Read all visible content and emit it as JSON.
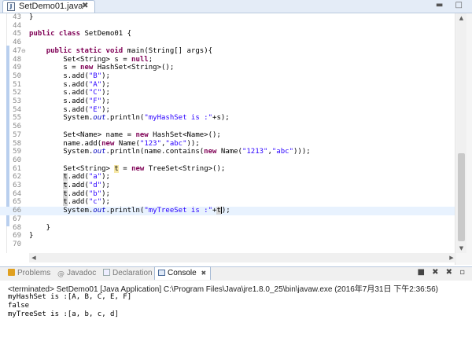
{
  "editor_tab": {
    "filename": "SetDemo01.java",
    "close": "✖"
  },
  "window_controls": "▬ □",
  "code_lines": [
    {
      "num": "43",
      "segments": [
        {
          "t": "}",
          "c": ""
        }
      ]
    },
    {
      "num": "44",
      "segments": []
    },
    {
      "num": "45",
      "segments": [
        {
          "t": "public class ",
          "c": "kw"
        },
        {
          "t": "SetDemo01 {",
          "c": ""
        }
      ]
    },
    {
      "num": "46",
      "segments": []
    },
    {
      "num": "47",
      "fold": "⊖",
      "segments": [
        {
          "t": "    ",
          "c": ""
        },
        {
          "t": "public static void ",
          "c": "kw"
        },
        {
          "t": "main(String[] ",
          "c": ""
        },
        {
          "t": "args",
          "c": ""
        },
        {
          "t": "){",
          "c": ""
        }
      ]
    },
    {
      "num": "48",
      "segments": [
        {
          "t": "        Set<String> s = ",
          "c": ""
        },
        {
          "t": "null",
          "c": "kw"
        },
        {
          "t": ";",
          "c": ""
        }
      ]
    },
    {
      "num": "49",
      "segments": [
        {
          "t": "        s = ",
          "c": ""
        },
        {
          "t": "new ",
          "c": "kw"
        },
        {
          "t": "HashSet<String>();",
          "c": ""
        }
      ]
    },
    {
      "num": "50",
      "segments": [
        {
          "t": "        s.add(",
          "c": ""
        },
        {
          "t": "\"B\"",
          "c": "str"
        },
        {
          "t": ");",
          "c": ""
        }
      ]
    },
    {
      "num": "51",
      "segments": [
        {
          "t": "        s.add(",
          "c": ""
        },
        {
          "t": "\"A\"",
          "c": "str"
        },
        {
          "t": ");",
          "c": ""
        }
      ]
    },
    {
      "num": "52",
      "segments": [
        {
          "t": "        s.add(",
          "c": ""
        },
        {
          "t": "\"C\"",
          "c": "str"
        },
        {
          "t": ");",
          "c": ""
        }
      ]
    },
    {
      "num": "53",
      "segments": [
        {
          "t": "        s.add(",
          "c": ""
        },
        {
          "t": "\"F\"",
          "c": "str"
        },
        {
          "t": ");",
          "c": ""
        }
      ]
    },
    {
      "num": "54",
      "segments": [
        {
          "t": "        s.add(",
          "c": ""
        },
        {
          "t": "\"E\"",
          "c": "str"
        },
        {
          "t": ");",
          "c": ""
        }
      ]
    },
    {
      "num": "55",
      "segments": [
        {
          "t": "        System.",
          "c": ""
        },
        {
          "t": "out",
          "c": "fld"
        },
        {
          "t": ".println(",
          "c": ""
        },
        {
          "t": "\"myHashSet is :\"",
          "c": "str"
        },
        {
          "t": "+s);",
          "c": ""
        }
      ]
    },
    {
      "num": "56",
      "segments": []
    },
    {
      "num": "57",
      "segments": [
        {
          "t": "        Set<Name> name = ",
          "c": ""
        },
        {
          "t": "new ",
          "c": "kw"
        },
        {
          "t": "HashSet<Name>();",
          "c": ""
        }
      ]
    },
    {
      "num": "58",
      "segments": [
        {
          "t": "        name.add(",
          "c": ""
        },
        {
          "t": "new ",
          "c": "kw"
        },
        {
          "t": "Name(",
          "c": ""
        },
        {
          "t": "\"123\"",
          "c": "str"
        },
        {
          "t": ",",
          "c": ""
        },
        {
          "t": "\"abc\"",
          "c": "str"
        },
        {
          "t": "));",
          "c": ""
        }
      ]
    },
    {
      "num": "59",
      "segments": [
        {
          "t": "        System.",
          "c": ""
        },
        {
          "t": "out",
          "c": "fld"
        },
        {
          "t": ".println(name.contains(",
          "c": ""
        },
        {
          "t": "new ",
          "c": "kw"
        },
        {
          "t": "Name(",
          "c": ""
        },
        {
          "t": "\"1213\"",
          "c": "str"
        },
        {
          "t": ",",
          "c": ""
        },
        {
          "t": "\"abc\"",
          "c": "str"
        },
        {
          "t": ")));",
          "c": ""
        }
      ]
    },
    {
      "num": "60",
      "segments": []
    },
    {
      "num": "61",
      "segments": [
        {
          "t": "        Set<String> ",
          "c": ""
        },
        {
          "t": "t",
          "c": "occw"
        },
        {
          "t": " = ",
          "c": ""
        },
        {
          "t": "new ",
          "c": "kw"
        },
        {
          "t": "TreeSet<String>();",
          "c": ""
        }
      ]
    },
    {
      "num": "62",
      "segments": [
        {
          "t": "        ",
          "c": ""
        },
        {
          "t": "t",
          "c": "occ"
        },
        {
          "t": ".add(",
          "c": ""
        },
        {
          "t": "\"a\"",
          "c": "str"
        },
        {
          "t": ");",
          "c": ""
        }
      ]
    },
    {
      "num": "63",
      "segments": [
        {
          "t": "        ",
          "c": ""
        },
        {
          "t": "t",
          "c": "occ"
        },
        {
          "t": ".add(",
          "c": ""
        },
        {
          "t": "\"d\"",
          "c": "str"
        },
        {
          "t": ");",
          "c": ""
        }
      ]
    },
    {
      "num": "64",
      "segments": [
        {
          "t": "        ",
          "c": ""
        },
        {
          "t": "t",
          "c": "occ"
        },
        {
          "t": ".add(",
          "c": ""
        },
        {
          "t": "\"b\"",
          "c": "str"
        },
        {
          "t": ");",
          "c": ""
        }
      ]
    },
    {
      "num": "65",
      "segments": [
        {
          "t": "        ",
          "c": ""
        },
        {
          "t": "t",
          "c": "occ"
        },
        {
          "t": ".add(",
          "c": ""
        },
        {
          "t": "\"c\"",
          "c": "str"
        },
        {
          "t": ");",
          "c": ""
        }
      ]
    },
    {
      "num": "66",
      "current": true,
      "segments": [
        {
          "t": "        System.",
          "c": ""
        },
        {
          "t": "out",
          "c": "fld"
        },
        {
          "t": ".println(",
          "c": ""
        },
        {
          "t": "\"myTreeSet is :\"",
          "c": "str"
        },
        {
          "t": "+",
          "c": ""
        },
        {
          "t": "t",
          "c": "occ"
        },
        {
          "t": "CARET",
          "c": "caret"
        },
        {
          "t": ");",
          "c": ""
        }
      ]
    },
    {
      "num": "67",
      "segments": []
    },
    {
      "num": "68",
      "segments": [
        {
          "t": "    }",
          "c": ""
        }
      ]
    },
    {
      "num": "69",
      "segments": [
        {
          "t": "}",
          "c": ""
        }
      ]
    },
    {
      "num": "70",
      "segments": []
    }
  ],
  "panel_tabs": {
    "problems": "Problems",
    "javadoc": "Javadoc",
    "declaration": "Declaration",
    "console": "Console",
    "console_close": "✖"
  },
  "panel_tools": "■ ✖ ✖ ▫",
  "console": {
    "terminated": "<terminated> SetDemo01 [Java Application] C:\\Program Files\\Java\\jre1.8.0_25\\bin\\javaw.exe (2016年7月31日 下午2:36:56)",
    "output": [
      "myHashSet is :[A, B, C, E, F]",
      "false",
      "myTreeSet is :[a, b, c, d]"
    ]
  },
  "colors": {
    "keyword": "#7f0055",
    "string": "#2a00ff",
    "field": "#0000c0",
    "current_line": "#e8f2fe"
  }
}
